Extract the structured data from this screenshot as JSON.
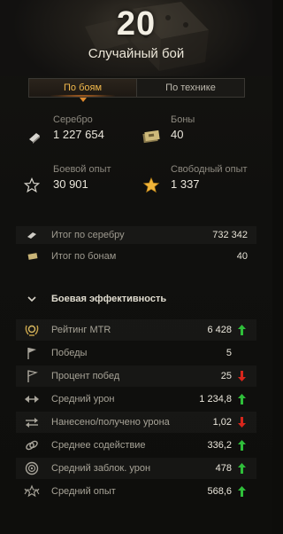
{
  "header": {
    "battle_count": "20",
    "battle_mode": "Случайный бой"
  },
  "tabs": [
    {
      "label": "По боям",
      "active": true
    },
    {
      "label": "По технике",
      "active": false
    }
  ],
  "resources": {
    "silver": {
      "label": "Серебро",
      "value": "1 227 654",
      "icon": "silver-icon"
    },
    "bonds": {
      "label": "Боны",
      "value": "40",
      "icon": "bonds-icon"
    },
    "combat_xp": {
      "label": "Боевой опыт",
      "value": "30 901",
      "icon": "star-outline-icon"
    },
    "free_xp": {
      "label": "Свободный опыт",
      "value": "1 337",
      "icon": "star-gold-icon"
    }
  },
  "totals": [
    {
      "label": "Итог по серебру",
      "value": "732 342",
      "icon": "silver-icon"
    },
    {
      "label": "Итог по бонам",
      "value": "40",
      "icon": "bonds-icon"
    }
  ],
  "section": {
    "title": "Боевая эффективность",
    "expanded": true
  },
  "stats": [
    {
      "label": "Рейтинг MTR",
      "value": "6 428",
      "trend": "up",
      "icon": "mtr-rating-icon"
    },
    {
      "label": "Победы",
      "value": "5",
      "trend": "none",
      "icon": "victory-flag-icon"
    },
    {
      "label": "Процент побед",
      "value": "25",
      "trend": "down",
      "icon": "win-rate-flag-icon"
    },
    {
      "label": "Средний урон",
      "value": "1 234,8",
      "trend": "up",
      "icon": "damage-icon"
    },
    {
      "label": "Нанесено/получено урона",
      "value": "1,02",
      "trend": "down",
      "icon": "damage-ratio-icon"
    },
    {
      "label": "Среднее содействие",
      "value": "336,2",
      "trend": "up",
      "icon": "assist-icon"
    },
    {
      "label": "Средний заблок. урон",
      "value": "478",
      "trend": "up",
      "icon": "blocked-damage-icon"
    },
    {
      "label": "Средний опыт",
      "value": "568,6",
      "trend": "up",
      "icon": "avg-xp-icon"
    }
  ],
  "colors": {
    "accent": "#f2b94c",
    "trend_up": "#2fbf3a",
    "trend_down": "#d8261c",
    "gold_star": "#f0b53a"
  }
}
